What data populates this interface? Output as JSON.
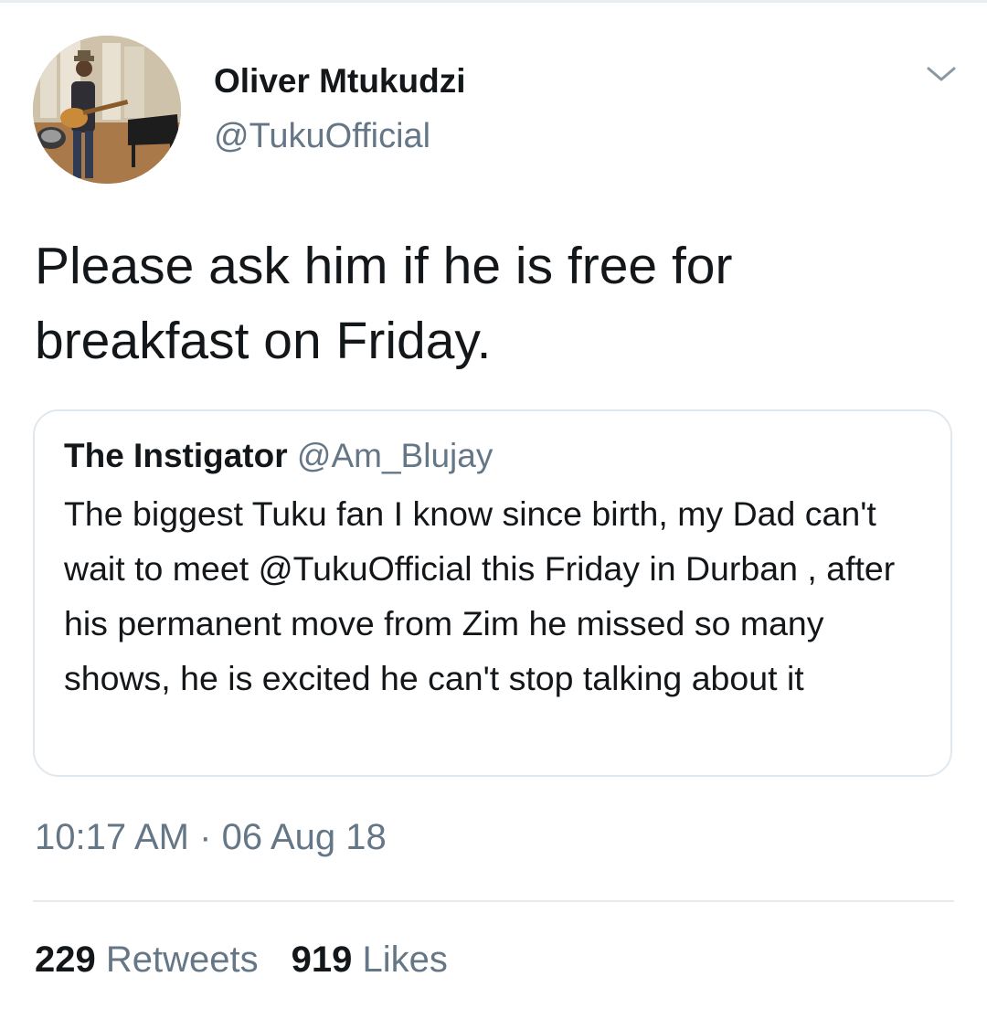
{
  "tweet": {
    "author_name": "Oliver Mtukudzi",
    "author_handle": "@TukuOfficial",
    "text": "Please ask him if he is free for breakfast on Friday.",
    "time": "10:17 AM",
    "separator": "·",
    "date": "06 Aug 18",
    "menu_icon": "chevron-down-icon"
  },
  "quoted_tweet": {
    "author_name": "The Instigator",
    "author_handle": "@Am_Blujay",
    "text": "The biggest Tuku fan I know since birth, my Dad can't wait to meet @TukuOfficial this Friday in Durban , after his permanent move from Zim he missed so many shows, he is excited he can't stop talking about it"
  },
  "stats": {
    "retweets_count": "229",
    "retweets_label": "Retweets",
    "likes_count": "919",
    "likes_label": "Likes"
  },
  "colors": {
    "primary_text": "#14171a",
    "secondary_text": "#657786",
    "border": "#e1e8ed"
  }
}
